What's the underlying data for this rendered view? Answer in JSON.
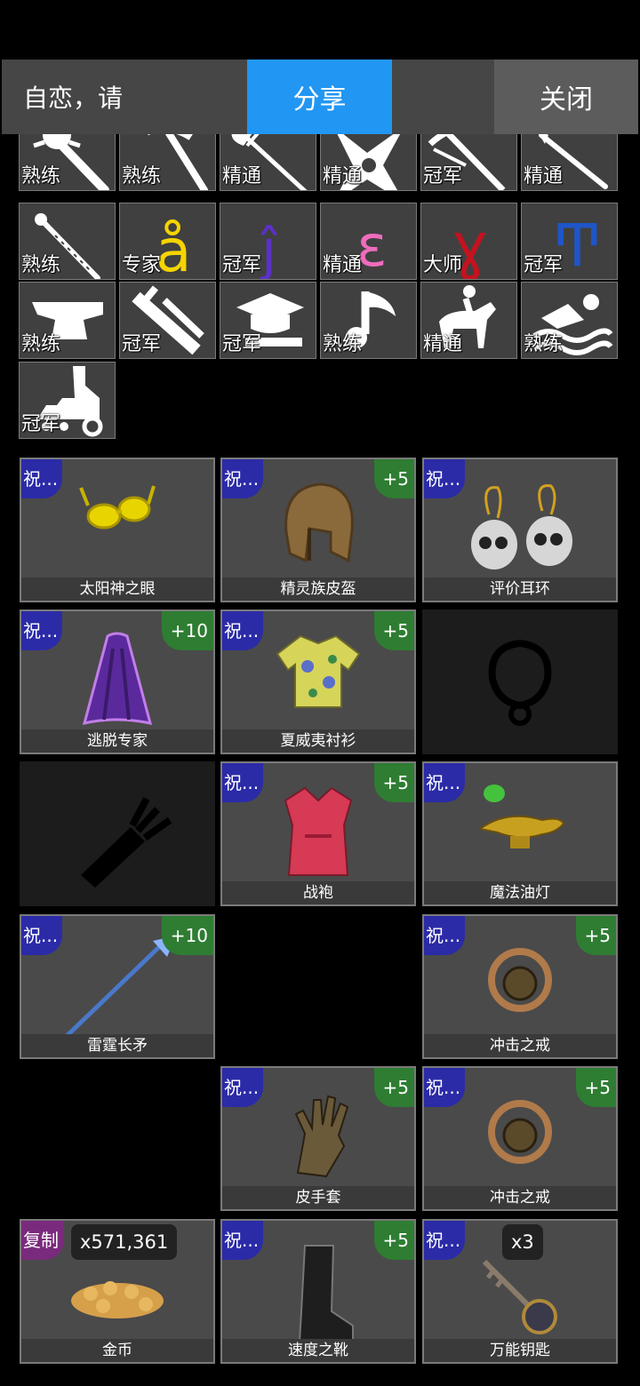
{
  "header": {
    "title": "自恋，请",
    "share_label": "分享",
    "close_label": "关闭"
  },
  "skills": [
    {
      "icon": "mace-icon",
      "level": "熟练"
    },
    {
      "icon": "pickaxe-icon",
      "level": "熟练"
    },
    {
      "icon": "halberd-icon",
      "level": "精通"
    },
    {
      "icon": "shuriken-icon",
      "level": "精通"
    },
    {
      "icon": "crossbow-icon",
      "level": "冠军"
    },
    {
      "icon": "spear-icon",
      "level": "精通"
    },
    {
      "icon": "staff-icon",
      "level": "熟练"
    },
    {
      "icon": "letter-a-ring-icon",
      "level": "专家"
    },
    {
      "icon": "letter-j-icon",
      "level": "冠军"
    },
    {
      "icon": "letter-e-icon",
      "level": "精通"
    },
    {
      "icon": "letter-y-icon",
      "level": "大师"
    },
    {
      "icon": "letter-t-icon",
      "level": "冠军"
    },
    {
      "icon": "anvil-icon",
      "level": "熟练"
    },
    {
      "icon": "tools-icon",
      "level": "冠军"
    },
    {
      "icon": "graduation-cap-icon",
      "level": "冠军"
    },
    {
      "icon": "music-note-icon",
      "level": "熟练"
    },
    {
      "icon": "horse-rider-icon",
      "level": "精通"
    },
    {
      "icon": "swimmer-icon",
      "level": "熟练"
    },
    {
      "icon": "tinkering-icon",
      "level": "冠军"
    }
  ],
  "items": [
    {
      "name": "太阳神之眼",
      "badge": "祝...",
      "plus": "",
      "count": "",
      "art": "sunglasses"
    },
    {
      "name": "精灵族皮盔",
      "badge": "祝...",
      "plus": "+5",
      "count": "",
      "art": "helmet"
    },
    {
      "name": "评价耳环",
      "badge": "祝...",
      "plus": "",
      "count": "",
      "art": "earrings"
    },
    {
      "name": "逃脱专家",
      "badge": "祝...",
      "plus": "+10",
      "count": "",
      "art": "cloak"
    },
    {
      "name": "夏威夷衬衫",
      "badge": "祝...",
      "plus": "+5",
      "count": "",
      "art": "shirt"
    },
    {
      "name": "",
      "badge": "",
      "plus": "",
      "count": "",
      "art": "necklace-slot",
      "empty": true
    },
    {
      "name": "",
      "badge": "",
      "plus": "",
      "count": "",
      "art": "quiver-slot",
      "empty": true
    },
    {
      "name": "战袍",
      "badge": "祝...",
      "plus": "+5",
      "count": "",
      "art": "robe"
    },
    {
      "name": "魔法油灯",
      "badge": "祝...",
      "plus": "",
      "count": "",
      "art": "lamp"
    },
    {
      "name": "雷霆长矛",
      "badge": "祝...",
      "plus": "+10",
      "count": "",
      "art": "spear"
    },
    null,
    {
      "name": "冲击之戒",
      "badge": "祝...",
      "plus": "+5",
      "count": "",
      "art": "ring"
    },
    null,
    {
      "name": "皮手套",
      "badge": "祝...",
      "plus": "+5",
      "count": "",
      "art": "glove"
    },
    {
      "name": "冲击之戒",
      "badge": "祝...",
      "plus": "+5",
      "count": "",
      "art": "ring"
    },
    {
      "name": "金币",
      "badge": "复制",
      "plus": "",
      "count": "x571,361",
      "art": "coins"
    },
    {
      "name": "速度之靴",
      "badge": "祝...",
      "plus": "+5",
      "count": "",
      "art": "boot"
    },
    {
      "name": "万能钥匙",
      "badge": "祝...",
      "plus": "",
      "count": "x3",
      "art": "key"
    }
  ]
}
